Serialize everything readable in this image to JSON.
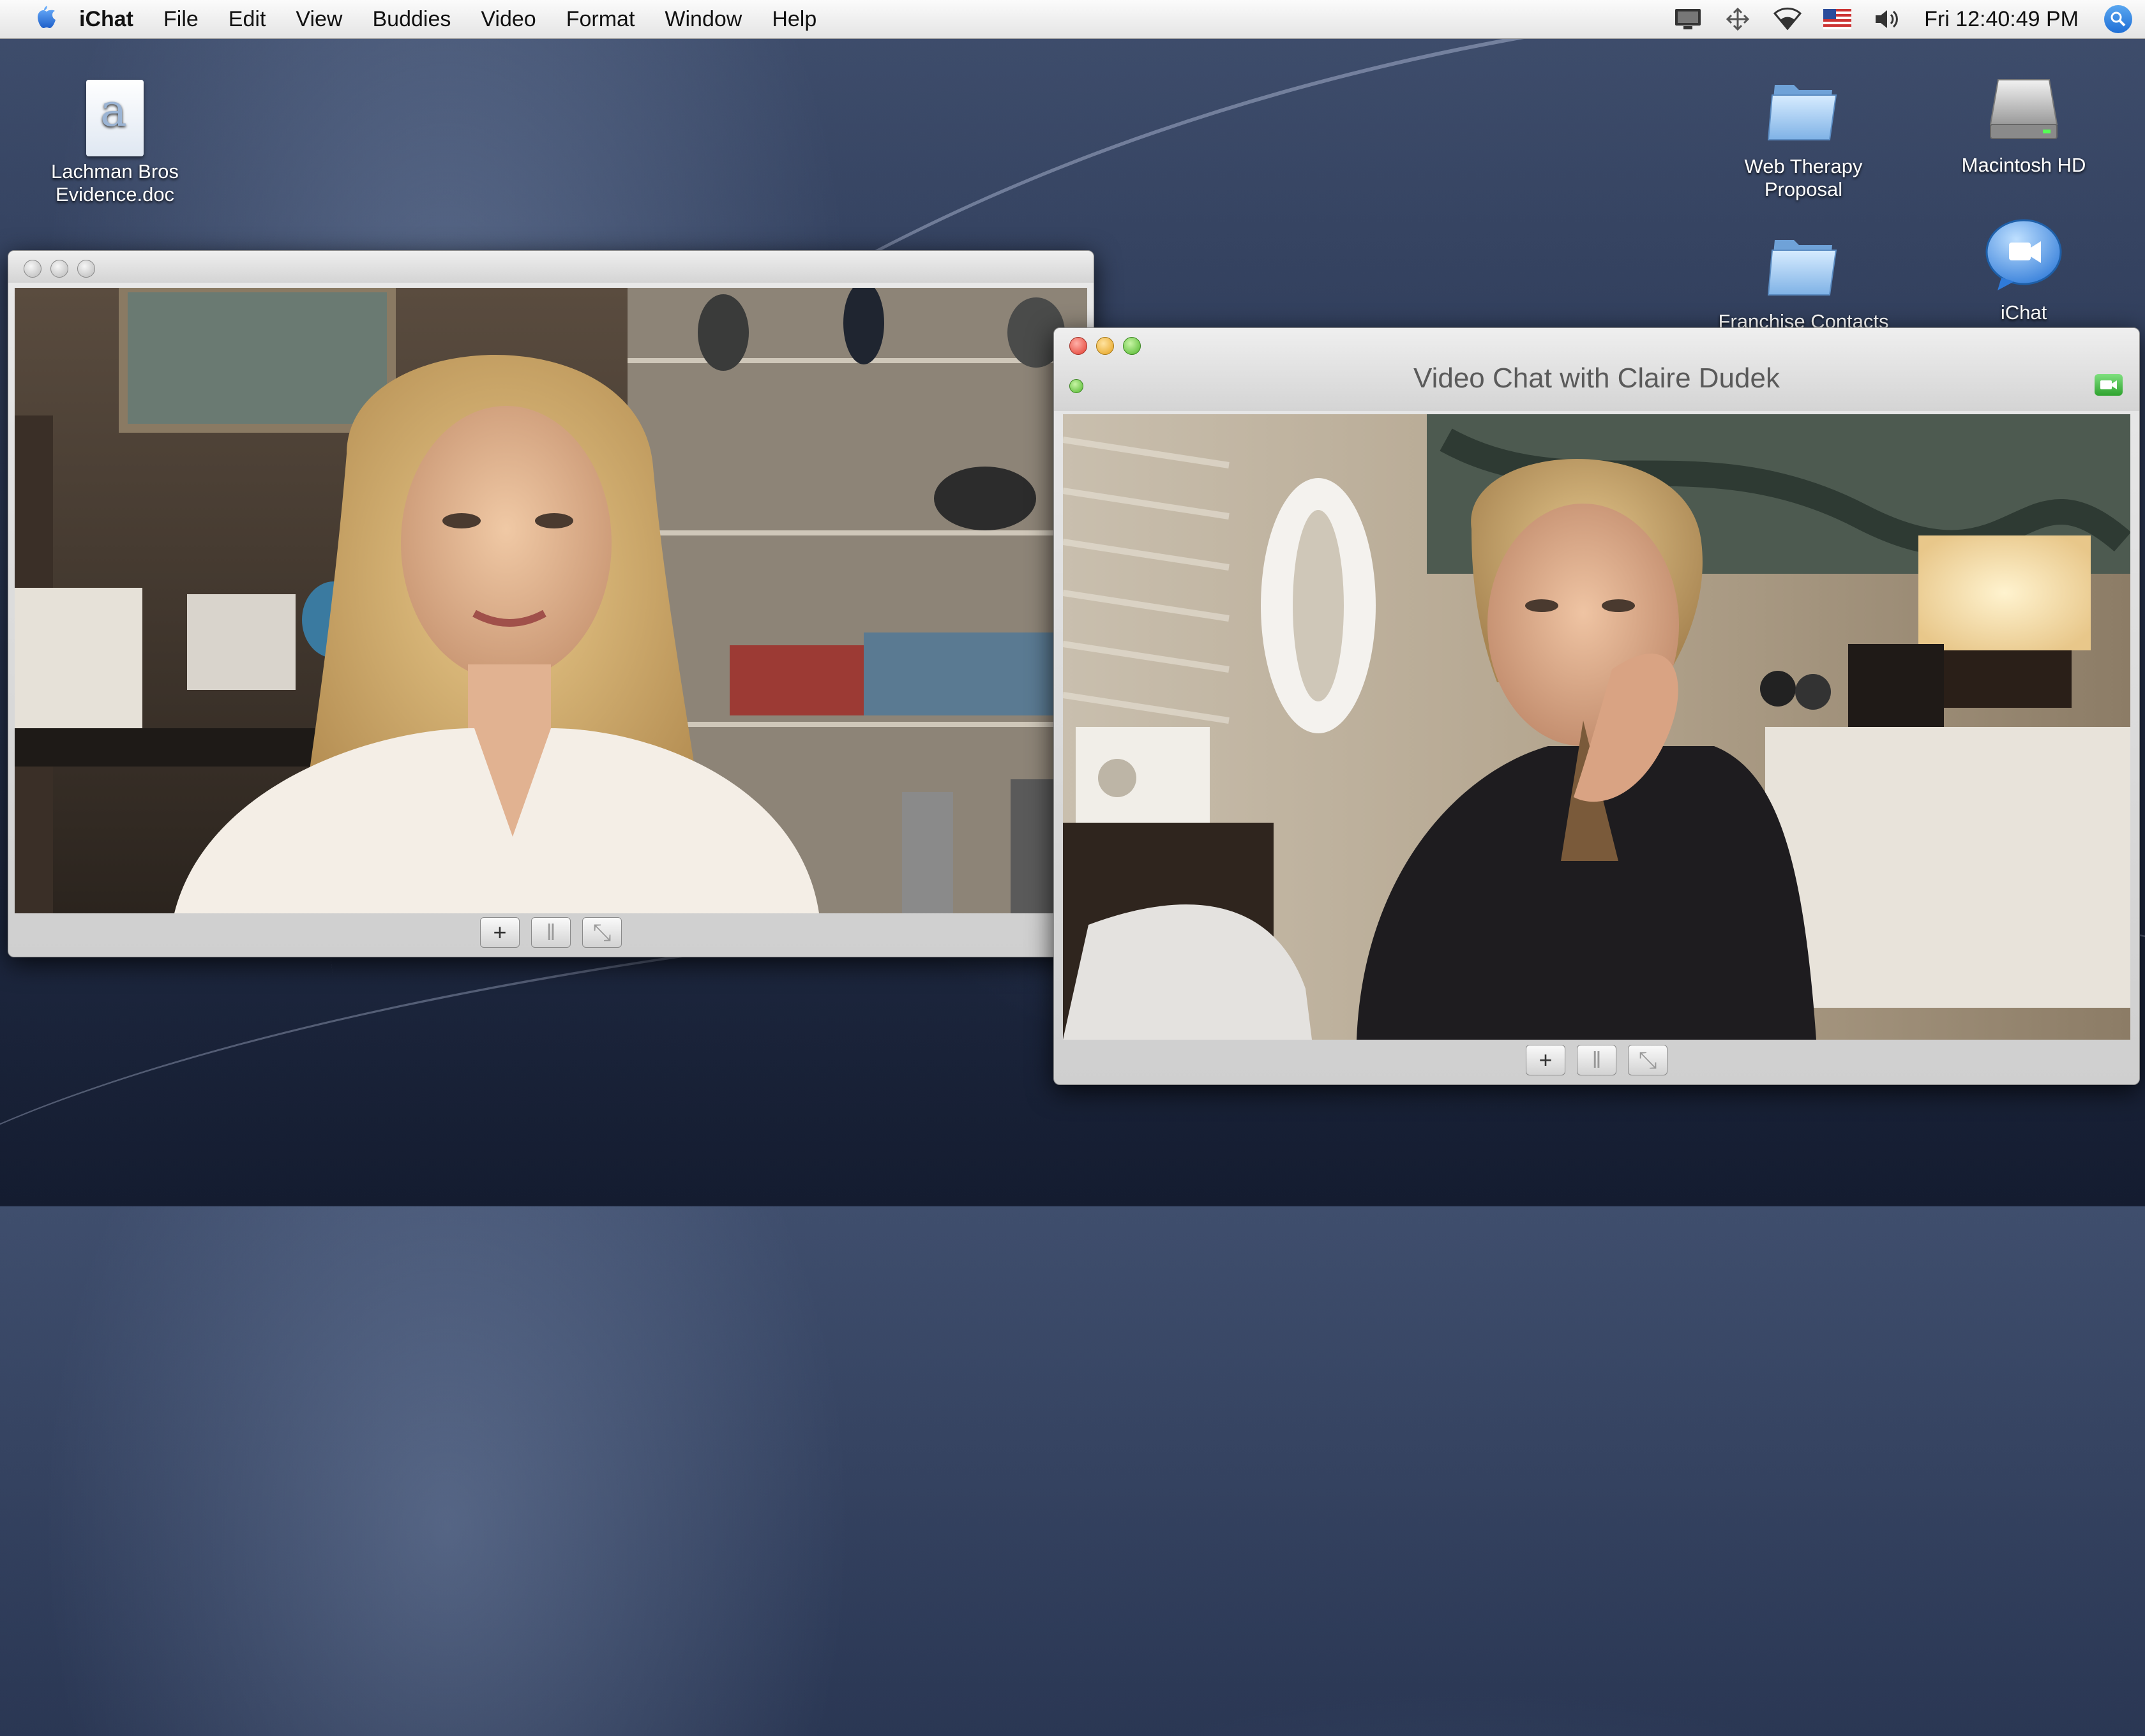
{
  "menubar": {
    "app_name": "iChat",
    "items": [
      "File",
      "Edit",
      "View",
      "Buddies",
      "Video",
      "Format",
      "Window",
      "Help"
    ],
    "clock": "Fri 12:40:49 PM"
  },
  "desktop": {
    "icons": [
      {
        "label_line1": "Lachman Bros",
        "label_line2": "Evidence.doc"
      },
      {
        "label_line1": "Web Therapy",
        "label_line2": "Proposal"
      },
      {
        "label_line1": "Macintosh HD",
        "label_line2": ""
      },
      {
        "label_line1": "Franchise Contacts",
        "label_line2": ""
      },
      {
        "label_line1": "iChat",
        "label_line2": ""
      }
    ]
  },
  "video_chat": {
    "title": "Video Chat with Claire Dudek"
  },
  "controls": {
    "add": "+",
    "mute": "‖",
    "fullscreen": "⤡"
  },
  "colors": {
    "accent_blue": "#2f7ad8",
    "close_red": "#e23b2e",
    "minimize_yellow": "#e5a11c",
    "zoom_green": "#4fb62b"
  }
}
